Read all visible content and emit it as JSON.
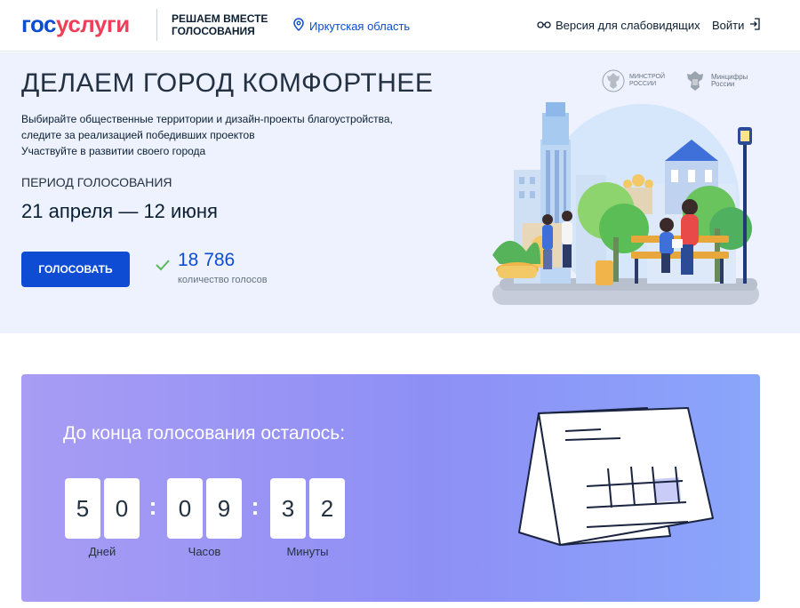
{
  "header": {
    "logo_part1": "гос",
    "logo_part2": "услуги",
    "project_line1": "Решаем вместе",
    "project_line2": "голосования",
    "region": "Иркутская область",
    "vision_label": "Версия для слабовидящих",
    "login_label": "Войти"
  },
  "hero": {
    "title": "ДЕЛАЕМ ГОРОД КОМФОРТНЕЕ",
    "desc_line1": "Выбирайте общественные территории и дизайн-проекты благоустройства,",
    "desc_line2": "следите за реализацией победивших проектов",
    "desc_line3": "Участвуйте в развитии своего города",
    "period_label": "Период голосования",
    "period_value": "21 апреля — 12 июня",
    "vote_button": "Голосовать",
    "votes_count": "18 786",
    "votes_label": "количество голосов",
    "ministry1_line1": "Минстрой",
    "ministry1_line2": "России",
    "ministry2_line1": "Минцифры",
    "ministry2_line2": "России"
  },
  "timer": {
    "title": "До конца голосования осталось:",
    "days": [
      "5",
      "0"
    ],
    "hours": [
      "0",
      "9"
    ],
    "minutes": [
      "3",
      "2"
    ],
    "days_label": "Дней",
    "hours_label": "Часов",
    "minutes_label": "Минуты"
  },
  "colors": {
    "brand_blue": "#0d4cd3",
    "brand_red": "#ee3f58",
    "hero_bg": "#edf2fe",
    "timer_gradient_start": "#a89cf4",
    "timer_gradient_end": "#8aa6fb",
    "check_green": "#5cb85c"
  },
  "icons": {
    "region": "location-pin-icon",
    "vision": "glasses-icon",
    "login": "login-arrow-icon",
    "votes": "checkmark-icon"
  }
}
